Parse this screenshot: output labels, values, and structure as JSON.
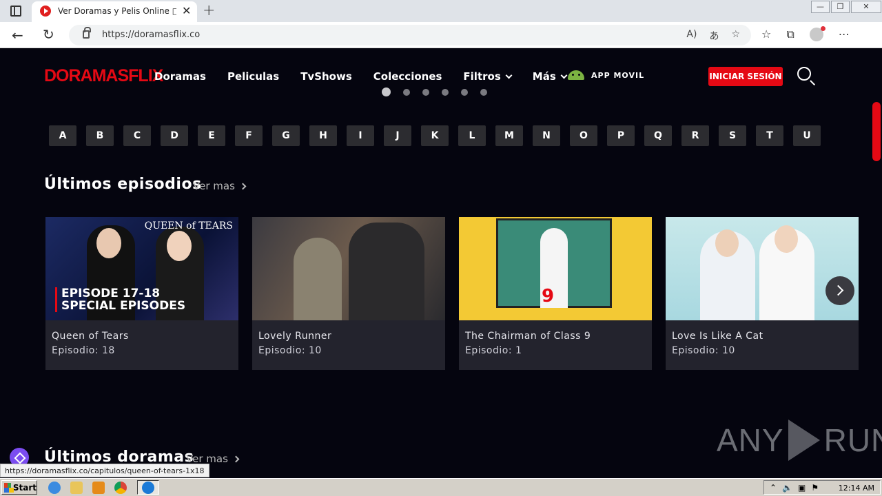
{
  "browser": {
    "tab_title": "Ver Doramas y Pelis Online □ Doramasflix",
    "tab_close": "✕",
    "new_tab": "+",
    "url": "https://doramasflix.co",
    "window_controls": {
      "minimize": "—",
      "restore": "❐",
      "close": "✕"
    }
  },
  "site": {
    "logo": "DORAMASFLIX",
    "nav": [
      {
        "label": "Doramas"
      },
      {
        "label": "Peliculas"
      },
      {
        "label": "TvShows"
      },
      {
        "label": "Colecciones"
      },
      {
        "label": "Filtros"
      },
      {
        "label": "Más"
      }
    ],
    "app_label": "APP MOVIL",
    "login_label": "INICIAR SESIÓN",
    "slider_dots": 6,
    "slider_active_index": 0
  },
  "letters": [
    "A",
    "B",
    "C",
    "D",
    "E",
    "F",
    "G",
    "H",
    "I",
    "J",
    "K",
    "L",
    "M",
    "N",
    "O",
    "P",
    "Q",
    "R",
    "S",
    "T",
    "U"
  ],
  "sections": {
    "latest_episodes": {
      "title": "Últimos episodios",
      "see_more": "Ver mas"
    },
    "latest_doramas": {
      "title": "Últimos doramas",
      "see_more": "Ver mas"
    }
  },
  "episodes": [
    {
      "title": "Queen of Tears",
      "episode": "Episodio: 18",
      "thumb_text": "EPISODE 17-18\nSPECIAL EPISODES",
      "thumb_title": "QUEEN of TEARS"
    },
    {
      "title": "Lovely Runner",
      "episode": "Episodio: 10"
    },
    {
      "title": "The Chairman of Class 9",
      "episode": "Episodio: 1",
      "thumb_number": "9"
    },
    {
      "title": "Love Is Like A Cat",
      "episode": "Episodio: 10"
    }
  ],
  "watermark": {
    "left": "ANY",
    "right": "RUN"
  },
  "status_url": "https://doramasflix.co/capitulos/queen-of-tears-1x18",
  "taskbar": {
    "start": "Start",
    "clock": "12:14 AM"
  }
}
